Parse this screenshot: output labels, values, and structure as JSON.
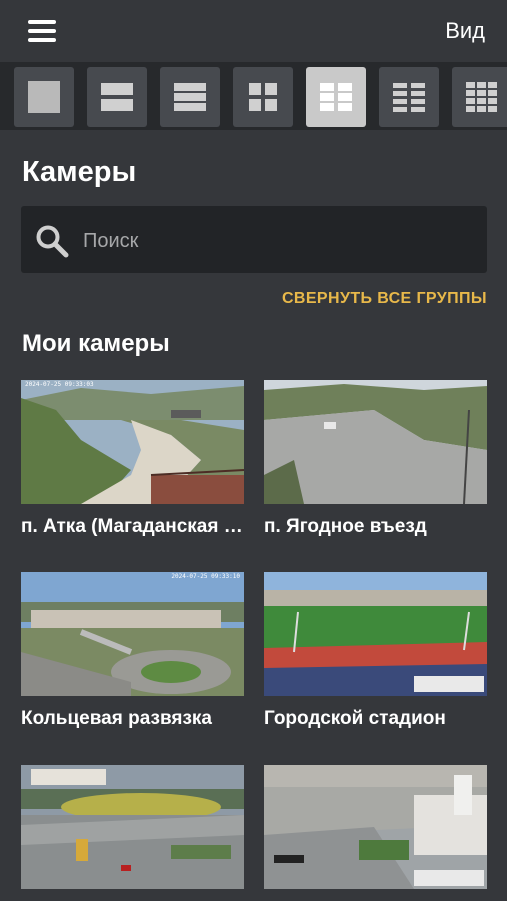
{
  "header": {
    "view_label": "Вид"
  },
  "layout_options": [
    {
      "name": "1x1",
      "selected": false
    },
    {
      "name": "1x2",
      "selected": false
    },
    {
      "name": "1x3",
      "selected": false
    },
    {
      "name": "2x2",
      "selected": false
    },
    {
      "name": "2x3",
      "selected": true
    },
    {
      "name": "2x4",
      "selected": false
    },
    {
      "name": "3x4",
      "selected": false
    }
  ],
  "page": {
    "title": "Камеры"
  },
  "search": {
    "placeholder": "Поиск",
    "value": ""
  },
  "collapse_all_label": "СВЕРНУТЬ ВСЕ ГРУППЫ",
  "group": {
    "title": "Мои камеры",
    "cameras": [
      {
        "label": "п. Атка (Магаданская трасса)",
        "timestamp": "2024-07-25 09:33:03"
      },
      {
        "label": "п. Ягодное въезд",
        "timestamp": ""
      },
      {
        "label": "Кольцевая развязка",
        "timestamp": "2024-07-25 09:33:10"
      },
      {
        "label": "Городской стадион",
        "timestamp": ""
      },
      {
        "label": "",
        "timestamp": ""
      },
      {
        "label": "",
        "timestamp": ""
      }
    ]
  },
  "colors": {
    "background": "#35373b",
    "strip": "#27292c",
    "accent": "#e8b84a",
    "selected_option": "#c9c9c9"
  }
}
